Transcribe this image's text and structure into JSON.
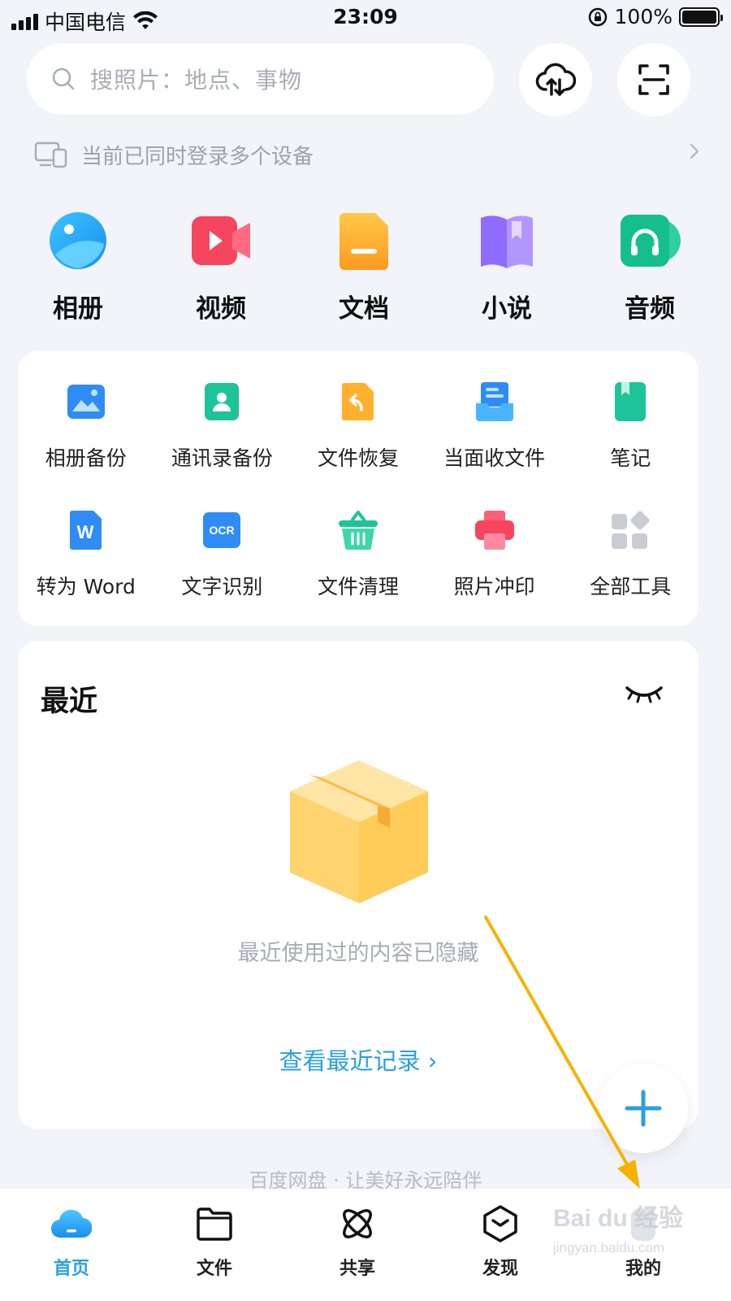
{
  "status_bar": {
    "carrier": "中国电信",
    "time": "23:09",
    "battery": "100%"
  },
  "search": {
    "placeholder": "搜照片：地点、事物"
  },
  "device_notice": {
    "text": "当前已同时登录多个设备"
  },
  "categories": [
    {
      "label": "相册",
      "icon": "album-icon"
    },
    {
      "label": "视频",
      "icon": "video-icon"
    },
    {
      "label": "文档",
      "icon": "document-icon"
    },
    {
      "label": "小说",
      "icon": "novel-icon"
    },
    {
      "label": "音频",
      "icon": "audio-icon"
    }
  ],
  "tools": [
    {
      "label": "相册备份",
      "icon": "album-backup-icon"
    },
    {
      "label": "通讯录备份",
      "icon": "contacts-backup-icon"
    },
    {
      "label": "文件恢复",
      "icon": "file-restore-icon"
    },
    {
      "label": "当面收文件",
      "icon": "receive-file-icon"
    },
    {
      "label": "笔记",
      "icon": "notes-icon"
    },
    {
      "label": "转为 Word",
      "icon": "convert-word-icon",
      "glyph": "W"
    },
    {
      "label": "文字识别",
      "icon": "ocr-icon",
      "glyph": "OCR"
    },
    {
      "label": "文件清理",
      "icon": "file-cleanup-icon"
    },
    {
      "label": "照片冲印",
      "icon": "photo-print-icon"
    },
    {
      "label": "全部工具",
      "icon": "all-tools-icon"
    }
  ],
  "recent": {
    "title": "最近",
    "hidden_message": "最近使用过的内容已隐藏",
    "view_link": "查看最近记录 ›"
  },
  "slogan": "百度网盘 · 让美好永远陪伴",
  "tabs": [
    {
      "label": "首页",
      "icon": "home-cloud-icon",
      "active": true
    },
    {
      "label": "文件",
      "icon": "folder-icon",
      "active": false
    },
    {
      "label": "共享",
      "icon": "share-atom-icon",
      "active": false
    },
    {
      "label": "发现",
      "icon": "discover-icon",
      "active": false
    },
    {
      "label": "我的",
      "icon": "profile-icon",
      "active": false
    }
  ],
  "watermark": {
    "logo": "Bai du 经验",
    "url": "jingyan.baidu.com"
  },
  "colors": {
    "accent": "#2aa0e0",
    "background": "#f2f4f9",
    "annotation_arrow": "#f5b300"
  }
}
